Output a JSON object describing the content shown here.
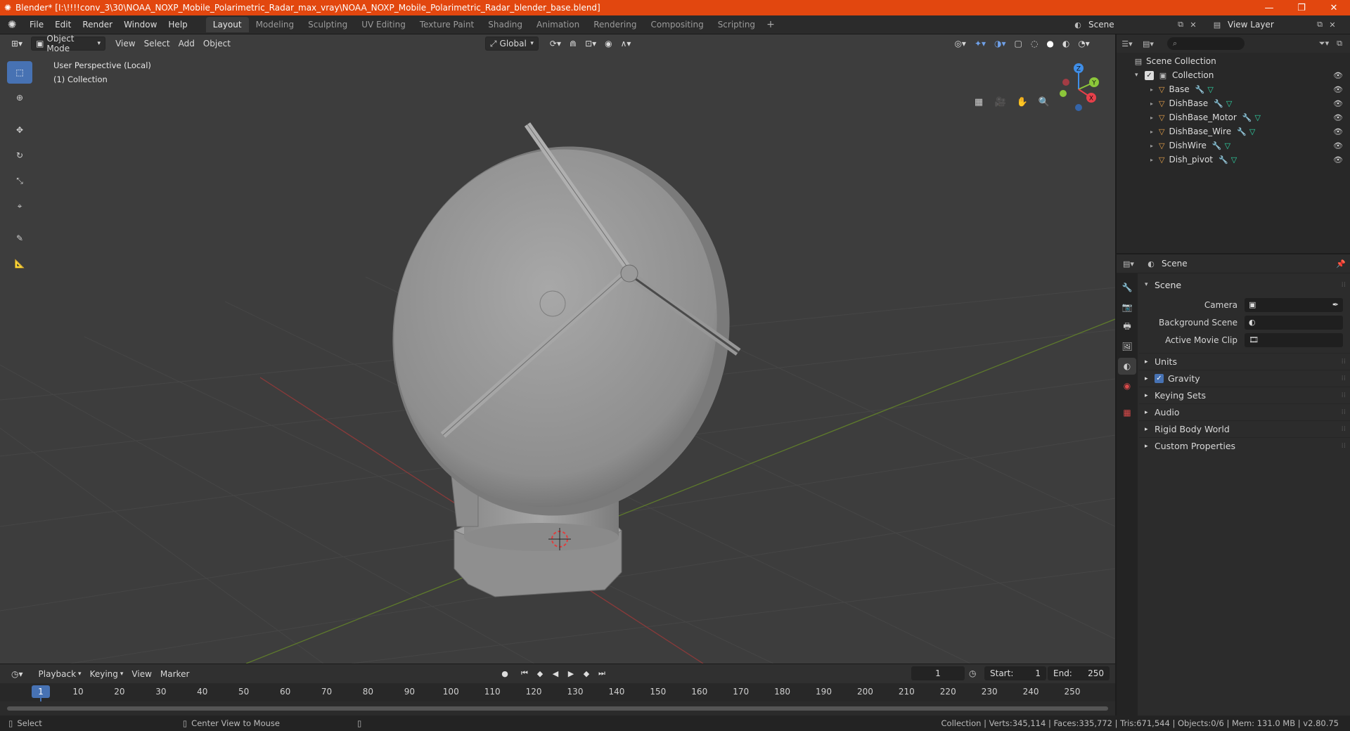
{
  "window": {
    "title": "Blender* [I:\\!!!!conv_3\\30\\NOAA_NOXP_Mobile_Polarimetric_Radar_max_vray\\NOAA_NOXP_Mobile_Polarimetric_Radar_blender_base.blend]",
    "minimize": "—",
    "restore": "❐",
    "close": "✕"
  },
  "menu": [
    "File",
    "Edit",
    "Render",
    "Window",
    "Help"
  ],
  "workspaces": [
    "Layout",
    "Modeling",
    "Sculpting",
    "UV Editing",
    "Texture Paint",
    "Shading",
    "Animation",
    "Rendering",
    "Compositing",
    "Scripting"
  ],
  "active_workspace": "Layout",
  "scene_selector": "Scene",
  "view_layer_selector": "View Layer",
  "viewport": {
    "mode": "Object Mode",
    "menus": [
      "View",
      "Select",
      "Add",
      "Object"
    ],
    "orientation": "Global",
    "info_line1": "User Perspective (Local)",
    "info_line2": "(1) Collection",
    "gizmo": {
      "z": "Z",
      "y": "Y",
      "x": "X"
    }
  },
  "outliner": {
    "root": "Scene Collection",
    "collection": "Collection",
    "objects": [
      "Base",
      "DishBase",
      "DishBase_Motor",
      "DishBase_Wire",
      "DishWire",
      "Dish_pivot"
    ]
  },
  "properties": {
    "header_title": "Scene",
    "panel": "Scene",
    "camera_label": "Camera",
    "background_scene_label": "Background Scene",
    "active_movie_clip_label": "Active Movie Clip",
    "subpanels": [
      "Units",
      "Gravity",
      "Keying Sets",
      "Audio",
      "Rigid Body World",
      "Custom Properties"
    ]
  },
  "timeline": {
    "menus": [
      "Playback",
      "Keying",
      "View",
      "Marker"
    ],
    "current_frame": "1",
    "start_label": "Start:",
    "start": "1",
    "end_label": "End:",
    "end": "250",
    "ticks": [
      "1",
      "10",
      "20",
      "30",
      "40",
      "50",
      "60",
      "70",
      "80",
      "90",
      "100",
      "110",
      "120",
      "130",
      "140",
      "150",
      "160",
      "170",
      "180",
      "190",
      "200",
      "210",
      "220",
      "230",
      "240",
      "250"
    ]
  },
  "statusbar": {
    "select": "Select",
    "center_view": "Center View to Mouse",
    "stats": "Collection | Verts:345,114 | Faces:335,772 | Tris:671,544 | Objects:0/6 | Mem: 131.0 MB | v2.80.75"
  },
  "colors": {
    "titlebar": "#e2470f",
    "accent": "#4772b3",
    "x_axis": "#e8404a",
    "y_axis": "#8cc63a",
    "z_axis": "#3f8ee8"
  }
}
